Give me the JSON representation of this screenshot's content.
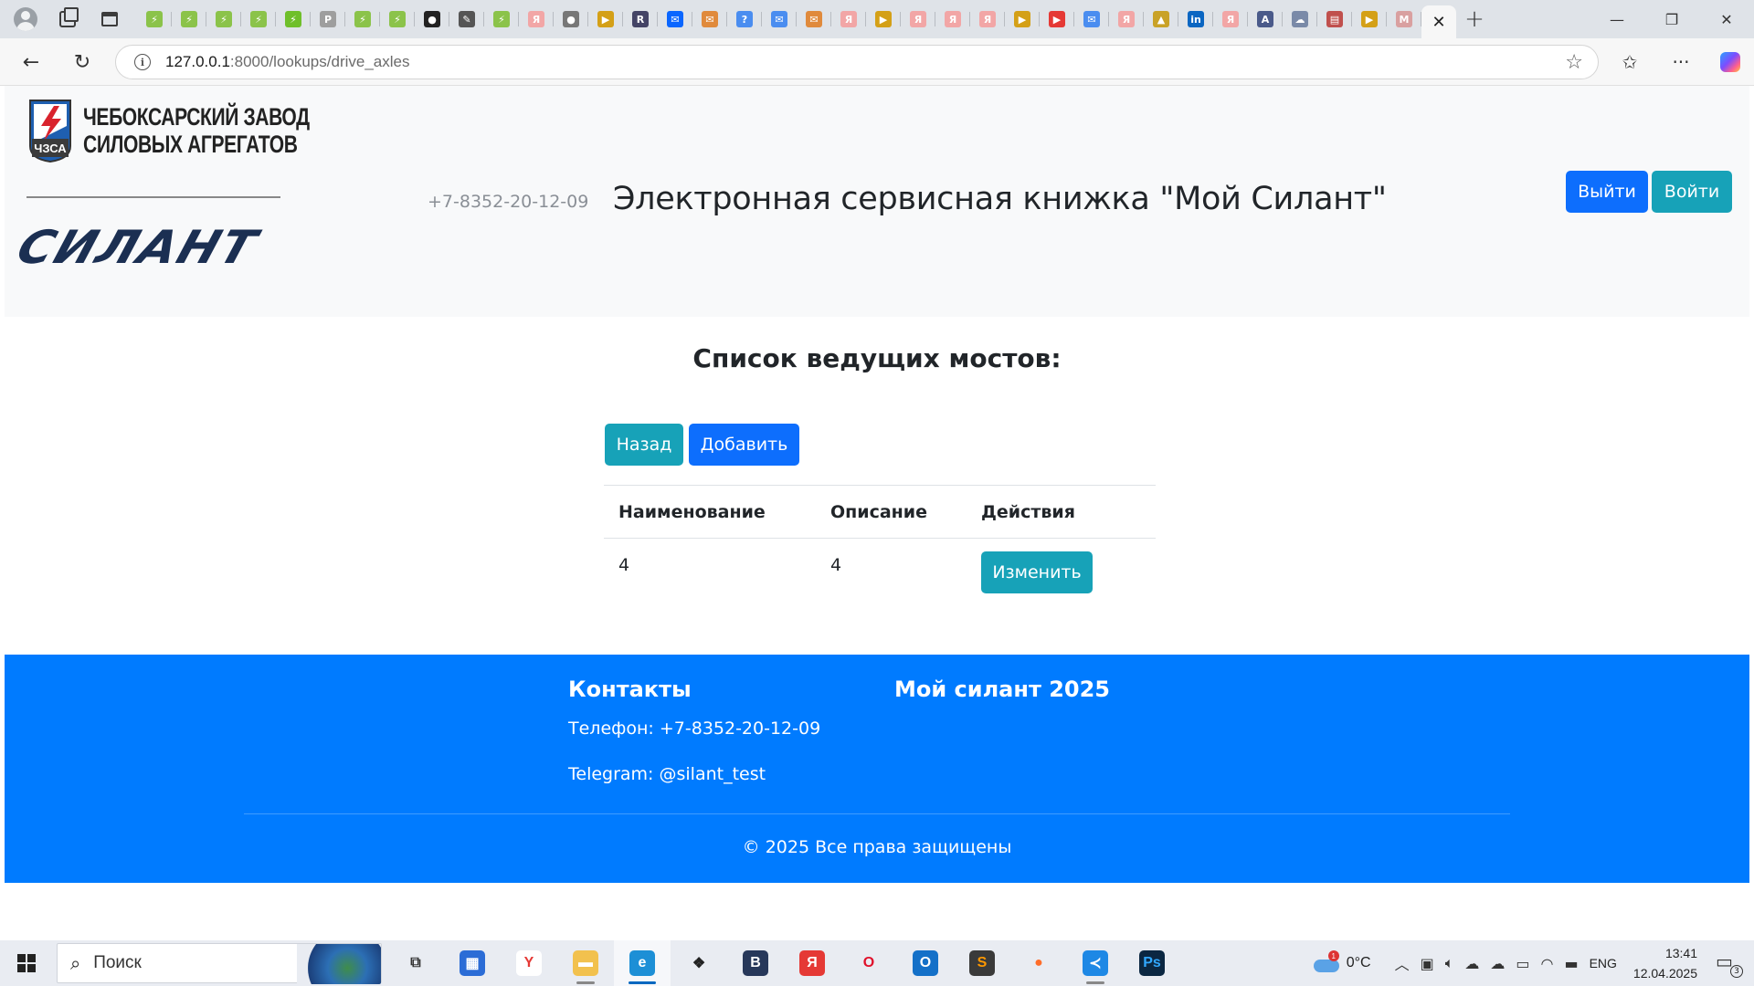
{
  "browser": {
    "url_host": "127.0.0.1",
    "url_path": ":8000/lookups/drive_axles",
    "tabs": [
      {
        "icon": "dev-site-icon",
        "color": "#8bc34a",
        "glyph": "⚡"
      },
      {
        "icon": "dev-site-icon",
        "color": "#8bc34a",
        "glyph": "⚡"
      },
      {
        "icon": "dev-site-icon",
        "color": "#8bc34a",
        "glyph": "⚡"
      },
      {
        "icon": "dev-site-icon",
        "color": "#8bc34a",
        "glyph": "⚡"
      },
      {
        "icon": "dev-site-icon",
        "color": "#6fbf2a",
        "glyph": "⚡"
      },
      {
        "icon": "p-site-icon",
        "color": "#9e9e9e",
        "glyph": "P"
      },
      {
        "icon": "dev-site-icon",
        "color": "#8bc34a",
        "glyph": "⚡"
      },
      {
        "icon": "dev-site-icon",
        "color": "#8bc34a",
        "glyph": "⚡"
      },
      {
        "icon": "github-icon",
        "color": "#222222",
        "glyph": "●"
      },
      {
        "icon": "notebook-icon",
        "color": "#555555",
        "glyph": "✎"
      },
      {
        "icon": "dev-site-icon",
        "color": "#8bc34a",
        "glyph": "⚡"
      },
      {
        "icon": "yandex-icon",
        "color": "#f2a6a6",
        "glyph": "Я"
      },
      {
        "icon": "github-icon",
        "color": "#777777",
        "glyph": "●"
      },
      {
        "icon": "video-icon",
        "color": "#d4a017",
        "glyph": "▶"
      },
      {
        "icon": "app-icon",
        "color": "#444466",
        "glyph": "R"
      },
      {
        "icon": "chat-icon",
        "color": "#0a66ff",
        "glyph": "✉"
      },
      {
        "icon": "mail-icon",
        "color": "#e08a3c",
        "glyph": "✉"
      },
      {
        "icon": "help-icon",
        "color": "#4a8df0",
        "glyph": "?"
      },
      {
        "icon": "mail-icon",
        "color": "#4a8df0",
        "glyph": "✉"
      },
      {
        "icon": "mail-icon",
        "color": "#e08a3c",
        "glyph": "✉"
      },
      {
        "icon": "yandex-icon",
        "color": "#f2a6a6",
        "glyph": "Я"
      },
      {
        "icon": "video-icon",
        "color": "#d4a017",
        "glyph": "▶"
      },
      {
        "icon": "yandex-icon",
        "color": "#f2a6a6",
        "glyph": "Я"
      },
      {
        "icon": "yandex-icon",
        "color": "#f2a6a6",
        "glyph": "Я"
      },
      {
        "icon": "yandex-icon",
        "color": "#f2a6a6",
        "glyph": "Я"
      },
      {
        "icon": "video-icon",
        "color": "#d4a017",
        "glyph": "▶"
      },
      {
        "icon": "youtube-icon",
        "color": "#e53935",
        "glyph": "▶"
      },
      {
        "icon": "chat-icon",
        "color": "#4a8df0",
        "glyph": "✉"
      },
      {
        "icon": "yandex-icon",
        "color": "#f2a6a6",
        "glyph": "Я"
      },
      {
        "icon": "image-icon",
        "color": "#c9a227",
        "glyph": "▲"
      },
      {
        "icon": "linkedin-icon",
        "color": "#0a66c2",
        "glyph": "in"
      },
      {
        "icon": "yandex-icon",
        "color": "#f2a6a6",
        "glyph": "Я"
      },
      {
        "icon": "translate-icon",
        "color": "#4a5a8a",
        "glyph": "A"
      },
      {
        "icon": "cloud-icon",
        "color": "#7a8aa8",
        "glyph": "☁"
      },
      {
        "icon": "pdf-icon",
        "color": "#c0504d",
        "glyph": "▤"
      },
      {
        "icon": "video-icon",
        "color": "#d4a017",
        "glyph": "▶"
      },
      {
        "icon": "gmail-icon",
        "color": "#d9a0a0",
        "glyph": "M"
      }
    ],
    "close_tab": "✕",
    "new_tab": "+",
    "window": {
      "minimize": "—",
      "maximize": "❐",
      "close": "✕"
    }
  },
  "header": {
    "company_line1": "ЧЕБОКСАРСКИЙ ЗАВОД",
    "company_line2": "СИЛОВЫХ АГРЕГАТОВ",
    "emblem_text": "ЧЗСА",
    "brand": "СИЛАНТ",
    "phone": "+7-8352-20-12-09",
    "title": "Электронная сервисная книжка \"Мой Силант\"",
    "logout_label": "Выйти",
    "login_label": "Войти",
    "colors": {
      "primary": "#0d6efd",
      "info": "#17a2b8",
      "brand_navy": "#1b2f52",
      "emblem_red": "#d9232d",
      "emblem_blue": "#1f5fb0"
    }
  },
  "main": {
    "heading": "Список ведущих мостов:",
    "back_label": "Назад",
    "add_label": "Добавить",
    "table": {
      "columns": [
        "Наименование",
        "Описание",
        "Действия"
      ],
      "rows": [
        {
          "name": "4",
          "description": "4",
          "action_label": "Изменить"
        }
      ]
    }
  },
  "footer": {
    "contacts_heading": "Контакты",
    "app_heading": "Мой силант 2025",
    "phone_text": "Телефон: +7-8352-20-12-09",
    "telegram_text": "Telegram: @silant_test",
    "copyright": "© 2025 Все права защищены",
    "background": "#007bff"
  },
  "taskbar": {
    "search_placeholder": "Поиск",
    "apps": [
      {
        "name": "task-view-icon",
        "glyph": "⧉",
        "color": "#e9ecf2",
        "fg": "#333",
        "running": false
      },
      {
        "name": "store-icon",
        "glyph": "▦",
        "color": "#2b6cd6",
        "fg": "#fff",
        "running": false
      },
      {
        "name": "yandex-browser-icon",
        "glyph": "Y",
        "color": "#ffffff",
        "fg": "#e53935",
        "running": false
      },
      {
        "name": "file-explorer-icon",
        "glyph": "▬",
        "color": "#f2c14e",
        "fg": "#fff",
        "running": true
      },
      {
        "name": "edge-icon",
        "glyph": "e",
        "color": "#1d8fd6",
        "fg": "#fff",
        "running": true,
        "active": true
      },
      {
        "name": "dropbox-icon",
        "glyph": "❖",
        "color": "#e9ecf2",
        "fg": "#222",
        "running": false
      },
      {
        "name": "vk-icon",
        "glyph": "B",
        "color": "#27385a",
        "fg": "#fff",
        "running": false
      },
      {
        "name": "yandex-icon",
        "glyph": "Я",
        "color": "#e53935",
        "fg": "#fff",
        "running": false
      },
      {
        "name": "opera-icon",
        "glyph": "O",
        "color": "#e9ecf2",
        "fg": "#e0102a",
        "running": false
      },
      {
        "name": "outlook-icon",
        "glyph": "O",
        "color": "#1470c8",
        "fg": "#fff",
        "running": false
      },
      {
        "name": "sublime-icon",
        "glyph": "S",
        "color": "#3a3a3a",
        "fg": "#ff9800",
        "running": false
      },
      {
        "name": "firefox-icon",
        "glyph": "●",
        "color": "#e9ecf2",
        "fg": "#ff6d2a",
        "running": false
      },
      {
        "name": "vscode-icon",
        "glyph": "≺",
        "color": "#1e88e5",
        "fg": "#fff",
        "running": true
      },
      {
        "name": "photoshop-icon",
        "glyph": "Ps",
        "color": "#0b2742",
        "fg": "#31a8ff",
        "running": false
      }
    ],
    "weather_alert": "1",
    "temperature": "0°C",
    "language": "ENG",
    "time": "13:41",
    "date": "12.04.2025",
    "notifications": "3"
  }
}
